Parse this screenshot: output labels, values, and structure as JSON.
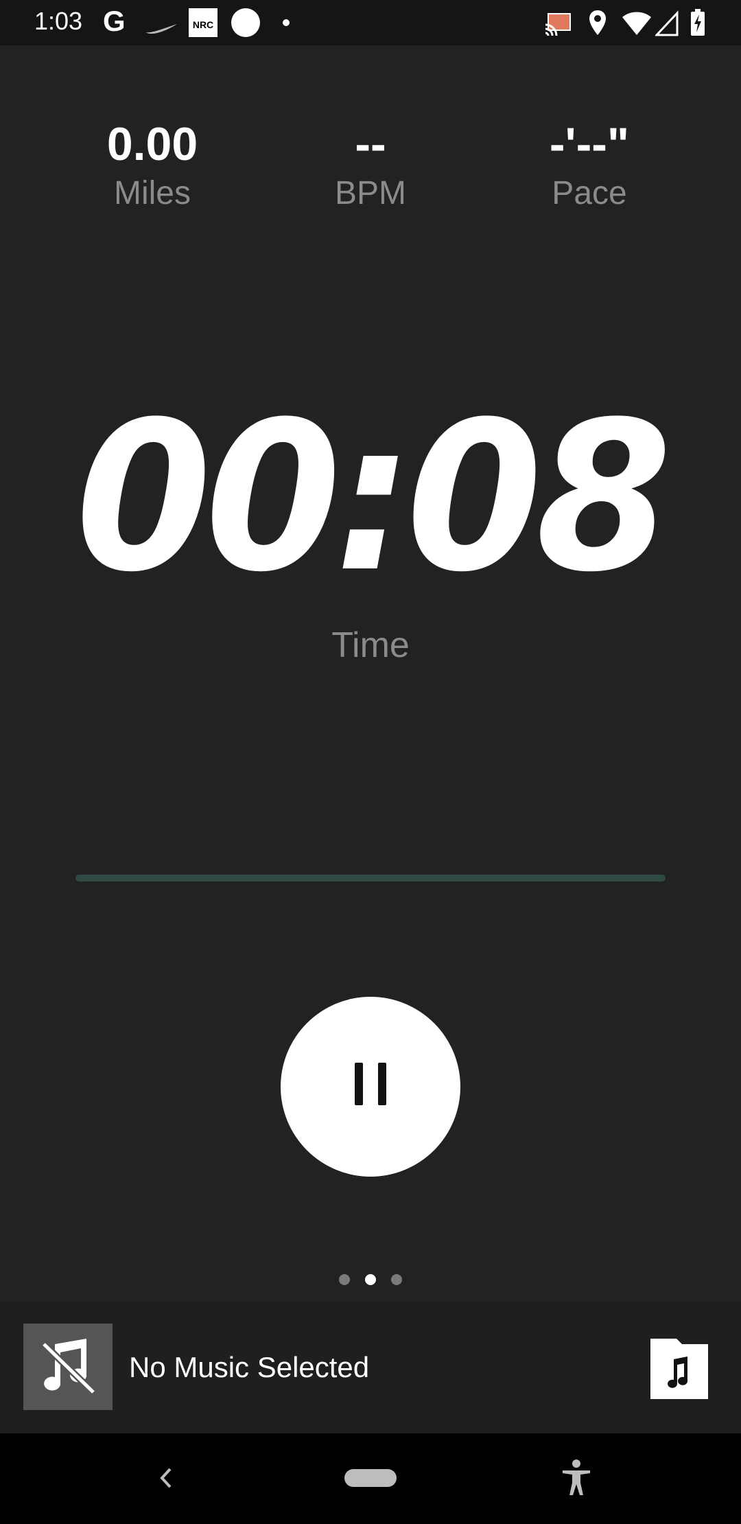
{
  "status_bar": {
    "time": "1:03",
    "google_letter": "G",
    "nrc_label": "NRC"
  },
  "stats": {
    "miles": {
      "value": "0.00",
      "label": "Miles"
    },
    "bpm": {
      "value": "--",
      "label": "BPM"
    },
    "pace": {
      "value": "-'--\"",
      "label": "Pace"
    }
  },
  "timer": {
    "value": "00:08",
    "label": "Time"
  },
  "progress": {
    "fraction": 0.0
  },
  "page_indicator": {
    "count": 3,
    "active_index": 1
  },
  "music": {
    "label": "No Music Selected"
  },
  "colors": {
    "background": "#222222",
    "muted_text": "#8b8b8b",
    "progress_track": "#2f4a44",
    "cast_accent": "#e07a5f"
  }
}
